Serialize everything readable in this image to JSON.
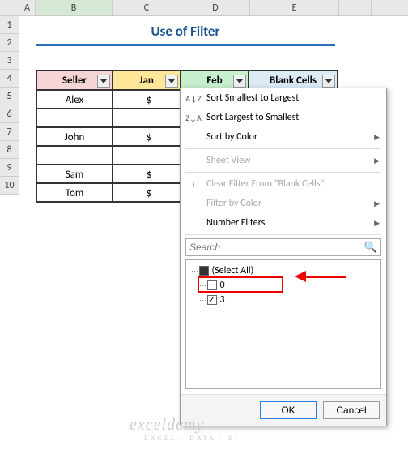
{
  "columns": {
    "A": "A",
    "B": "B",
    "C": "C",
    "D": "D",
    "E": "E",
    "F": ""
  },
  "rows": [
    "1",
    "2",
    "3",
    "4",
    "5",
    "6",
    "7",
    "8",
    "9",
    "10"
  ],
  "title": "Use of Filter",
  "headers": {
    "seller": "Seller",
    "jan": "Jan",
    "feb": "Feb",
    "blank": "Blank Cells"
  },
  "data": [
    {
      "seller": "Alex",
      "jan": "$"
    },
    {
      "seller": "",
      "jan": ""
    },
    {
      "seller": "John",
      "jan": "$"
    },
    {
      "seller": "",
      "jan": ""
    },
    {
      "seller": "Sam",
      "jan": "$"
    },
    {
      "seller": "Tom",
      "jan": "$"
    }
  ],
  "menu": {
    "sort_asc": "Sort Smallest to Largest",
    "sort_desc": "Sort Largest to Smallest",
    "sort_color": "Sort by Color",
    "sheet_view": "Sheet View",
    "clear_filter": "Clear Filter From \"Blank Cells\"",
    "filter_color": "Filter by Color",
    "number_filters": "Number Filters",
    "search_placeholder": "Search",
    "items": {
      "select_all": "(Select All)",
      "zero": "0",
      "three": "3"
    },
    "ok": "OK",
    "cancel": "Cancel",
    "icon_asc": "A↓Z",
    "icon_desc": "Z↓A"
  },
  "watermark": {
    "brand": "exceldemy",
    "tag": "EXCEL · DATA · BI"
  }
}
